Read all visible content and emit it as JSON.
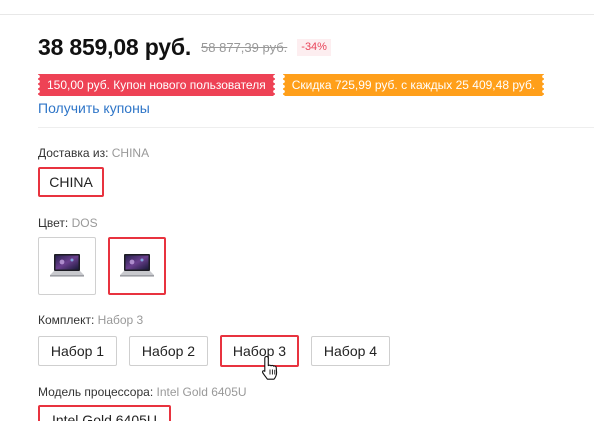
{
  "price": {
    "current": "38 859,08 руб.",
    "old": "58 877,39 руб.",
    "discount": "-34%"
  },
  "coupons": {
    "new_user": "150,00 руб. Купон нового пользователя",
    "discount": "Скидка 725,99 руб. с каждых 25 409,48 руб.",
    "get_link": "Получить купоны"
  },
  "shipping": {
    "label": "Доставка из:",
    "value": "CHINA",
    "options": [
      "CHINA"
    ]
  },
  "color": {
    "label": "Цвет:",
    "value": "DOS",
    "swatch_icons": [
      "laptop-thumbnail-icon",
      "laptop-thumbnail-icon"
    ],
    "selected_index": 1
  },
  "bundle": {
    "label": "Комплект:",
    "value": "Набор 3",
    "options": [
      "Набор 1",
      "Набор 2",
      "Набор 3",
      "Набор 4"
    ],
    "selected_index": 2
  },
  "cpu": {
    "label": "Модель процессора:",
    "value": "Intel Gold 6405U",
    "options": [
      "Intel Gold 6405U"
    ]
  },
  "colors": {
    "accent_red": "#e8333f",
    "coupon_red": "#ee4255",
    "coupon_orange": "#ff9f1a",
    "link_blue": "#2f76c8"
  }
}
